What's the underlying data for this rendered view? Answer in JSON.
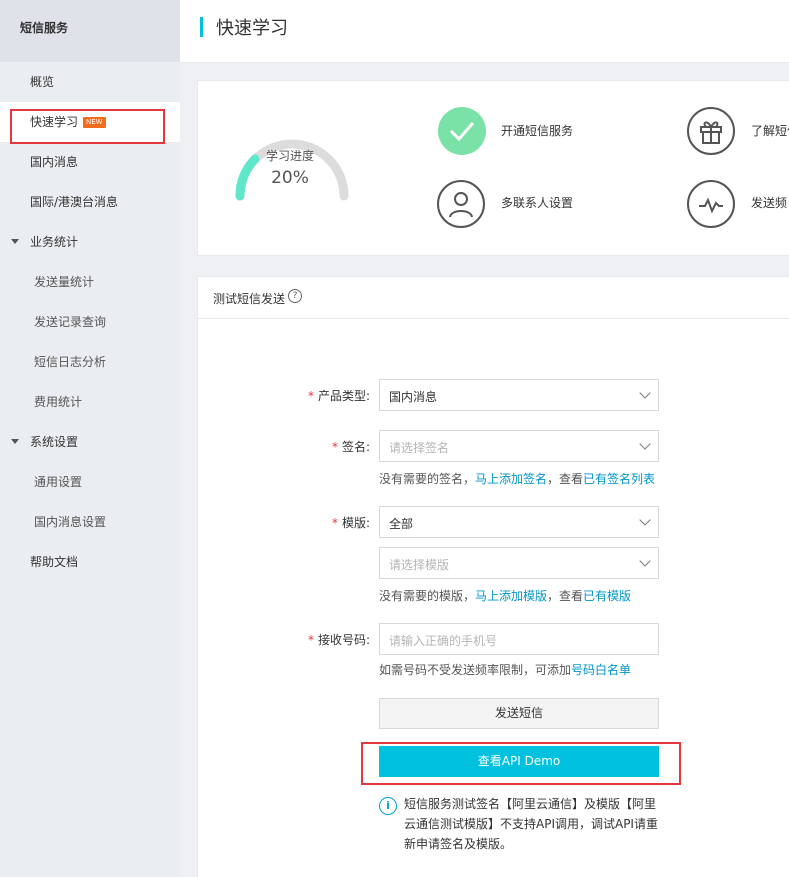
{
  "sidebar": {
    "header": "短信服务",
    "items": [
      {
        "label": "概览"
      },
      {
        "label": "快速学习",
        "badge": "NEW"
      },
      {
        "label": "国内消息"
      },
      {
        "label": "国际/港澳台消息"
      },
      {
        "label": "业务统计"
      },
      {
        "label": "发送量统计"
      },
      {
        "label": "发送记录查询"
      },
      {
        "label": "短信日志分析"
      },
      {
        "label": "费用统计"
      },
      {
        "label": "系统设置"
      },
      {
        "label": "通用设置"
      },
      {
        "label": "国内消息设置"
      },
      {
        "label": "帮助文档"
      }
    ]
  },
  "header": {
    "title": "快速学习"
  },
  "progress": {
    "label": "学习进度",
    "value_text": "20%",
    "value": 0.2
  },
  "features": [
    {
      "label": "开通短信服务",
      "icon": "check-icon"
    },
    {
      "label": "了解短信",
      "icon": "gift-icon"
    },
    {
      "label": "多联系人设置",
      "icon": "user-icon"
    },
    {
      "label": "发送频",
      "icon": "pulse-icon"
    }
  ],
  "form": {
    "title": "测试短信发送",
    "help": "?",
    "product_type": {
      "label": "产品类型:",
      "value": "国内消息"
    },
    "signature": {
      "label": "签名:",
      "placeholder": "请选择签名",
      "hint_prefix": "没有需要的签名，",
      "hint_link1": "马上添加签名",
      "hint_mid": "，查看",
      "hint_link2": "已有签名列表"
    },
    "template": {
      "label": "模版:",
      "value": "全部",
      "placeholder": "请选择模版",
      "hint_prefix": "没有需要的模版，",
      "hint_link1": "马上添加模版",
      "hint_mid": "，查看",
      "hint_link2": "已有模版"
    },
    "phone": {
      "label": "接收号码:",
      "placeholder": "请输入正确的手机号",
      "hint_prefix": "如需号码不受发送频率限制，可添加",
      "hint_link": "号码白名单"
    },
    "send_button": "发送短信",
    "demo_button": "查看API Demo",
    "note_icon": "i",
    "note": "短信服务测试签名【阿里云通信】及模版【阿里云通信测试模版】不支持API调用，调试API请重新申请签名及模版。"
  },
  "colors": {
    "accent": "#00c1de",
    "link": "#0095c9",
    "success": "#7be2a7",
    "badge": "#f56c1d",
    "highlight": "#e4393c"
  }
}
